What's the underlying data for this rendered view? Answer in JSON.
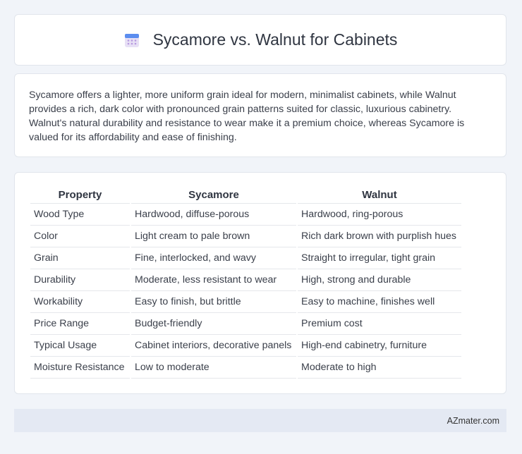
{
  "header": {
    "title": "Sycamore vs. Walnut for Cabinets",
    "icon": "calendar-icon",
    "colors": {
      "icon_top": "#5b8def",
      "icon_body": "#e7e0f5",
      "icon_dots": "#b79ae0"
    }
  },
  "intro": {
    "text": "Sycamore offers a lighter, more uniform grain ideal for modern, minimalist cabinets, while Walnut provides a rich, dark color with pronounced grain patterns suited for classic, luxurious cabinetry. Walnut's natural durability and resistance to wear make it a premium choice, whereas Sycamore is valued for its affordability and ease of finishing."
  },
  "table": {
    "headers": [
      "Property",
      "Sycamore",
      "Walnut"
    ],
    "rows": [
      [
        "Wood Type",
        "Hardwood, diffuse-porous",
        "Hardwood, ring-porous"
      ],
      [
        "Color",
        "Light cream to pale brown",
        "Rich dark brown with purplish hues"
      ],
      [
        "Grain",
        "Fine, interlocked, and wavy",
        "Straight to irregular, tight grain"
      ],
      [
        "Durability",
        "Moderate, less resistant to wear",
        "High, strong and durable"
      ],
      [
        "Workability",
        "Easy to finish, but brittle",
        "Easy to machine, finishes well"
      ],
      [
        "Price Range",
        "Budget-friendly",
        "Premium cost"
      ],
      [
        "Typical Usage",
        "Cabinet interiors, decorative panels",
        "High-end cabinetry, furniture"
      ],
      [
        "Moisture Resistance",
        "Low to moderate",
        "Moderate to high"
      ]
    ]
  },
  "footer": {
    "text": "AZmater.com"
  }
}
